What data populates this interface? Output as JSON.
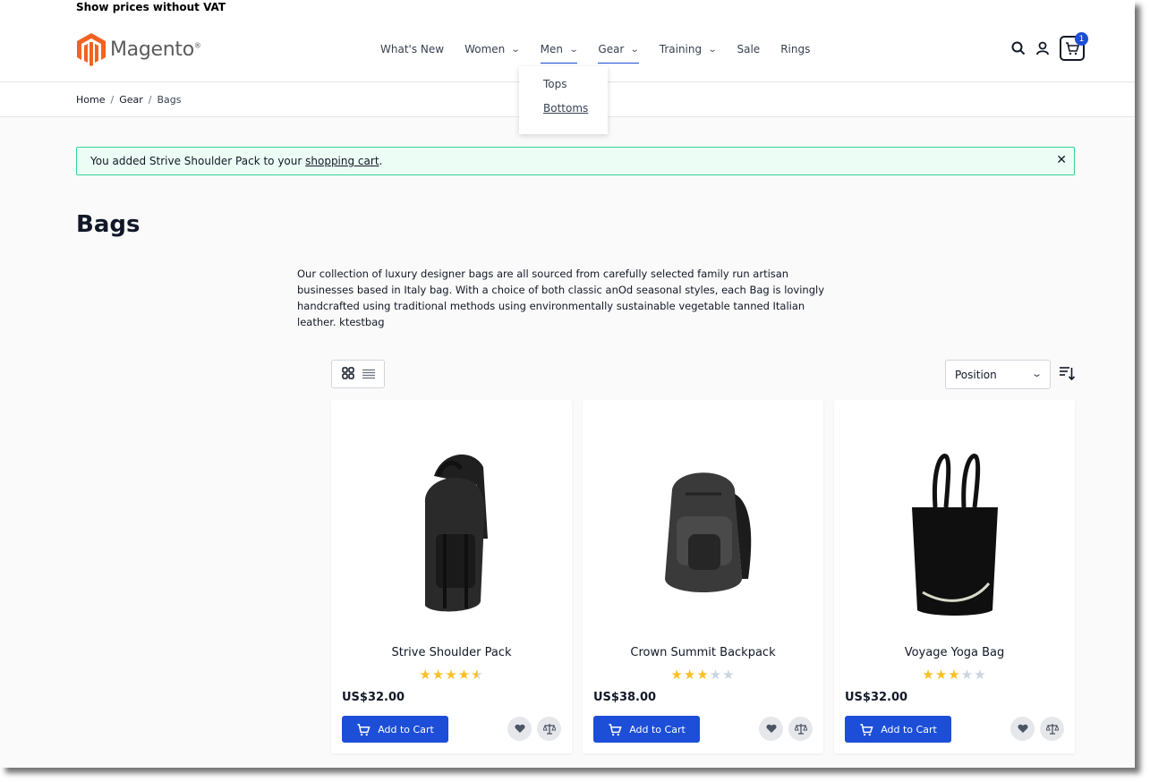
{
  "topbar": {
    "vat_label": "Show prices without VAT"
  },
  "header": {
    "logo_text": "Magento",
    "logo_reg": "®",
    "nav": [
      {
        "label": "What's New",
        "has_dropdown": false
      },
      {
        "label": "Women",
        "has_dropdown": true
      },
      {
        "label": "Men",
        "has_dropdown": true
      },
      {
        "label": "Gear",
        "has_dropdown": true
      },
      {
        "label": "Training",
        "has_dropdown": true
      },
      {
        "label": "Sale",
        "has_dropdown": false
      },
      {
        "label": "Rings",
        "has_dropdown": false
      }
    ],
    "dropdown_items": [
      "Tops",
      "Bottoms"
    ],
    "cart_count": "1"
  },
  "breadcrumb": {
    "items": [
      "Home",
      "Gear",
      "Bags"
    ],
    "separator": "/"
  },
  "message": {
    "prefix": "You added Strive Shoulder Pack to your ",
    "link": "shopping cart",
    "suffix": ".",
    "close": "✕"
  },
  "page": {
    "title": "Bags",
    "description": "Our collection of luxury designer bags are all sourced from carefully selected family run artisan businesses based in Italy bag. With a choice of both classic anOd seasonal styles, each Bag is lovingly handcrafted using traditional methods using environmentally sustainable vegetable tanned Italian leather. ktestbag"
  },
  "toolbar": {
    "sort_value": "Position"
  },
  "products": [
    {
      "name": "Strive Shoulder Pack",
      "price": "US$32.00",
      "rating": 4.5,
      "add_label": "Add to Cart"
    },
    {
      "name": "Crown Summit Backpack",
      "price": "US$38.00",
      "rating": 3,
      "add_label": "Add to Cart"
    },
    {
      "name": "Voyage Yoga Bag",
      "price": "US$32.00",
      "rating": 3,
      "add_label": "Add to Cart"
    }
  ],
  "colors": {
    "primary": "#1d4ed8",
    "logo_orange": "#f26322",
    "success_bg": "#ecfdf5",
    "success_border": "#34d399",
    "star": "#fbbf24"
  }
}
